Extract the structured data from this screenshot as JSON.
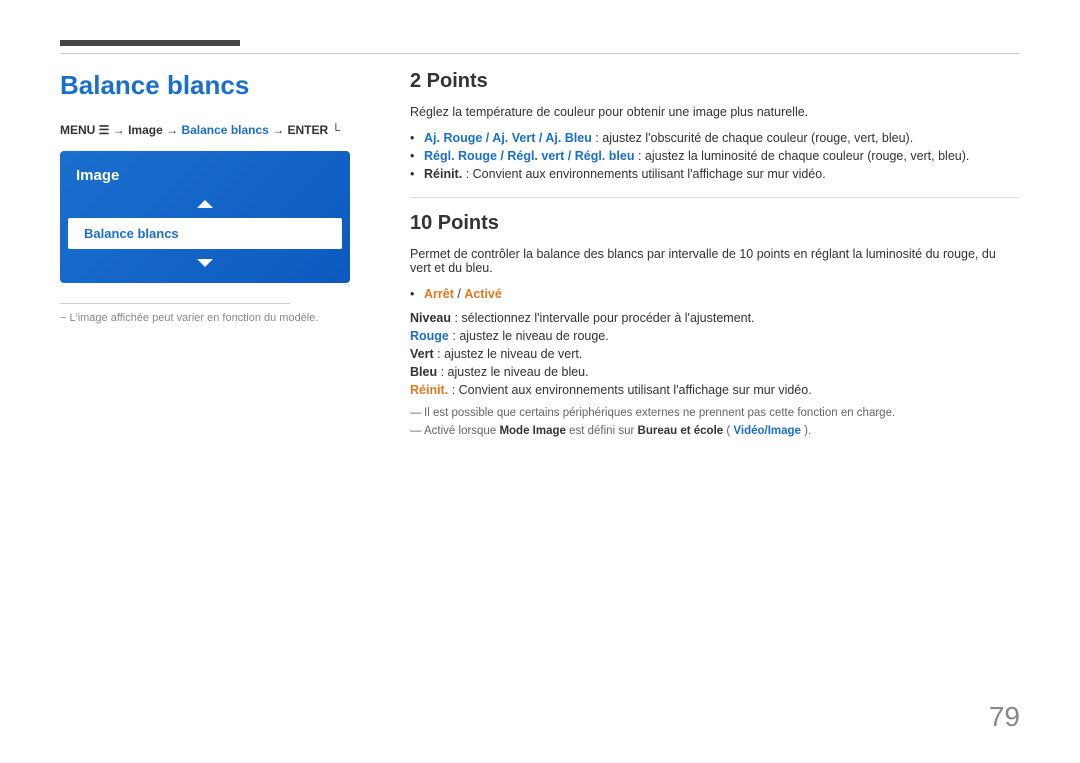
{
  "page": {
    "number": "79"
  },
  "left": {
    "title": "Balance blancs",
    "menu_path_prefix": "MENU",
    "menu_path": "→ Image → Balance blancs → ENTER",
    "menu_highlight": "Balance blancs",
    "nav_title": "Image",
    "nav_selected": "Balance blancs",
    "divider_note": "− L'image affichée peut varier en fonction du modèle."
  },
  "right": {
    "section1": {
      "title": "2 Points",
      "description": "Réglez la température de couleur pour obtenir une image plus naturelle.",
      "bullets": [
        {
          "prefix_bold": "Aj. Rouge / Aj. Vert / Aj. Bleu",
          "text": " : ajustez l'obscurité de chaque couleur (rouge, vert, bleu)."
        },
        {
          "prefix_bold": "Régl. Rouge / Régl. vert / Régl. bleu",
          "text": " : ajustez la luminosité de chaque couleur (rouge, vert, bleu)."
        },
        {
          "prefix_bold": "Réinit.",
          "text": ": Convient aux environnements utilisant l'affichage sur mur vidéo."
        }
      ]
    },
    "section2": {
      "title": "10 Points",
      "description": "Permet de contrôler la balance des blancs par intervalle de 10 points en réglant la luminosité du rouge, du vert et du bleu.",
      "bullet_options": "Arrêt / Activé",
      "items": [
        {
          "bold": "Niveau",
          "text": " : sélectionnez l'intervalle pour procéder à l'ajustement."
        },
        {
          "bold": "Rouge",
          "text": " : ajustez le niveau de rouge."
        },
        {
          "bold": "Vert",
          "text": " : ajustez le niveau de vert."
        },
        {
          "bold": "Bleu",
          "text": " : ajustez le niveau de bleu."
        },
        {
          "bold": "Réinit.",
          "text": ": Convient aux environnements utilisant l'affichage sur mur vidéo."
        }
      ],
      "notes": [
        "Il est possible que certains périphériques externes ne prennent pas cette fonction en charge.",
        "Activé lorsque Mode Image est défini sur Bureau et école (Vidéo/Image)."
      ]
    }
  }
}
